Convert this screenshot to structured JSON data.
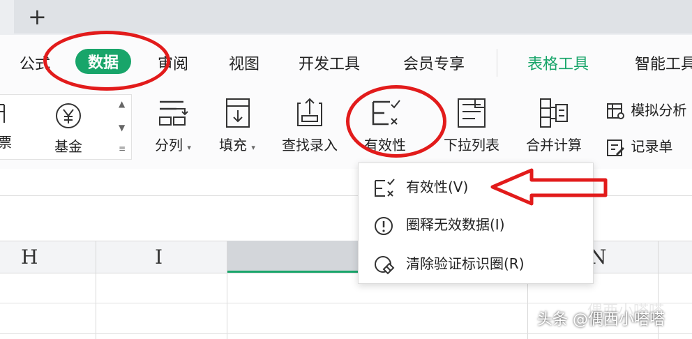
{
  "tabbar": {
    "new_tab_symbol": "+"
  },
  "menu": {
    "items": [
      {
        "label": "公式"
      },
      {
        "label": "数据",
        "active": true
      },
      {
        "label": "审阅"
      },
      {
        "label": "视图"
      },
      {
        "label": "开发工具"
      },
      {
        "label": "会员专享"
      },
      {
        "label": "表格工具"
      },
      {
        "label": "智能工具"
      }
    ]
  },
  "ribbon": {
    "partial_left_label": "票",
    "gallery": {
      "fund_label": "基金",
      "fund_icon": "yen-icon"
    },
    "buttons": [
      {
        "label": "分列",
        "icon": "split-columns-icon",
        "has_caret": true
      },
      {
        "label": "填充",
        "icon": "fill-down-icon",
        "has_caret": true
      },
      {
        "label": "查找录入",
        "icon": "lookup-entry-icon"
      },
      {
        "label": "有效性",
        "icon": "validation-icon"
      },
      {
        "label": "下拉列表",
        "icon": "dropdown-list-icon"
      },
      {
        "label": "合并计算",
        "icon": "consolidate-icon"
      }
    ],
    "small_buttons": [
      {
        "label": "模拟分析",
        "icon": "what-if-icon"
      },
      {
        "label": "记录单",
        "icon": "record-form-icon"
      }
    ]
  },
  "sheet": {
    "columns": [
      "H",
      "I",
      "",
      "N"
    ]
  },
  "dropdown": {
    "items": [
      {
        "label": "有效性(V)",
        "icon": "validation-icon"
      },
      {
        "label": "圈释无效数据(I)",
        "icon": "alert-circle-icon"
      },
      {
        "label": "清除验证标识圈(R)",
        "icon": "clear-circle-icon"
      }
    ]
  },
  "annotations": {
    "color": "#e21b1b"
  },
  "theme": {
    "accent": "#18a56a"
  },
  "watermark": {
    "text": "头条 @偶西小嗒嗒",
    "ghost": "偶西小嗒嗒"
  }
}
